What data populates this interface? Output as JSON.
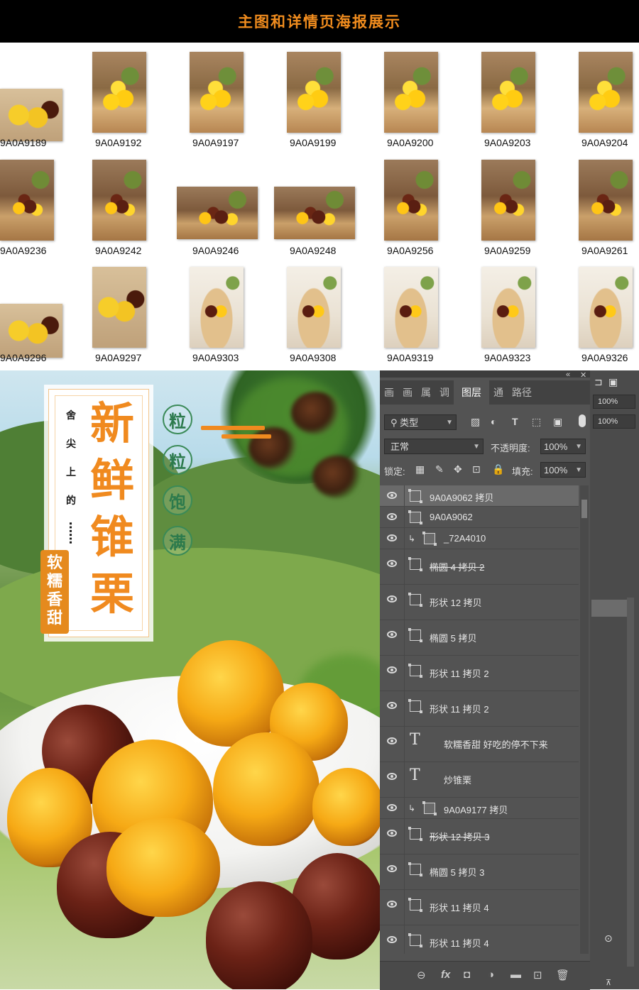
{
  "header": {
    "title": "主图和详情页海报展示"
  },
  "thumbnails": [
    {
      "id": "9A0A9189",
      "style": "ph-cut"
    },
    {
      "id": "9A0A9192",
      "style": "ph-yellow"
    },
    {
      "id": "9A0A9197",
      "style": "ph-yellow"
    },
    {
      "id": "9A0A9199",
      "style": "ph-yellow"
    },
    {
      "id": "9A0A9200",
      "style": "ph-yellow"
    },
    {
      "id": "9A0A9203",
      "style": "ph-yellow"
    },
    {
      "id": "9A0A9204",
      "style": "ph-yellow"
    },
    {
      "id": "9A0A9236",
      "style": "ph-mixed"
    },
    {
      "id": "9A0A9242",
      "style": "ph-mixed"
    },
    {
      "id": "9A0A9246",
      "style": "ph-mixed"
    },
    {
      "id": "9A0A9248",
      "style": "ph-mixed"
    },
    {
      "id": "9A0A9256",
      "style": "ph-mixed"
    },
    {
      "id": "9A0A9259",
      "style": "ph-mixed"
    },
    {
      "id": "9A0A9261",
      "style": "ph-mixed"
    },
    {
      "id": "9A0A9296",
      "style": "ph-cut"
    },
    {
      "id": "9A0A9297",
      "style": "ph-cut"
    },
    {
      "id": "9A0A9303",
      "style": "ph-cream"
    },
    {
      "id": "9A0A9308",
      "style": "ph-cream"
    },
    {
      "id": "9A0A9319",
      "style": "ph-cream"
    },
    {
      "id": "9A0A9323",
      "style": "ph-cream"
    },
    {
      "id": "9A0A9326",
      "style": "ph-cream"
    }
  ],
  "poster": {
    "small_chars": [
      "舍",
      "尖",
      "上",
      "的"
    ],
    "small_dots": "……",
    "big_chars": [
      "新",
      "鲜",
      "锥",
      "栗"
    ],
    "side_tag": [
      "软",
      "糯",
      "香",
      "甜"
    ],
    "circle_chars": [
      "粒",
      "粒",
      "饱",
      "满"
    ]
  },
  "photoshop": {
    "tabs": [
      "画",
      "画",
      "属",
      "调",
      "图层",
      "通",
      "路径"
    ],
    "active_tab": "图层",
    "filter_kind": "类型",
    "blend_mode": "正常",
    "opacity_label": "不透明度:",
    "opacity_value": "100%",
    "lock_label": "锁定:",
    "fill_label": "填充:",
    "fill_value": "100%",
    "right_field_1": "100%",
    "right_field_2": "100%",
    "layers": [
      {
        "name": "9A0A9062 拷贝",
        "type": "smart",
        "selected": true,
        "short": true
      },
      {
        "name": "9A0A9062",
        "type": "smart",
        "short": true
      },
      {
        "name": "_72A4010",
        "type": "smart",
        "clip": true,
        "short": true
      },
      {
        "name": "椭圆 4 拷贝 2",
        "type": "shape",
        "strike": true
      },
      {
        "name": "形状 12 拷贝",
        "type": "shape"
      },
      {
        "name": "椭圆 5 拷贝",
        "type": "shape"
      },
      {
        "name": "形状 11 拷贝 2",
        "type": "shape"
      },
      {
        "name": "形状 11 拷贝 2",
        "type": "shape"
      },
      {
        "name": "软糯香甜 好吃的停不下来",
        "type": "text"
      },
      {
        "name": "炒锥栗",
        "type": "text"
      },
      {
        "name": "9A0A9177 拷贝",
        "type": "smart",
        "clip": true,
        "short": true
      },
      {
        "name": "形状 12 拷贝 3",
        "type": "shape",
        "strike": true
      },
      {
        "name": "椭圆 5 拷贝 3",
        "type": "shape"
      },
      {
        "name": "形状 11 拷贝 4",
        "type": "shape"
      },
      {
        "name": "形状 11 拷贝 4",
        "type": "shape"
      }
    ],
    "bottom_icons": [
      "link-icon",
      "fx-icon",
      "mask-icon",
      "adjustment-icon",
      "folder-icon",
      "new-layer-icon",
      "trash-icon"
    ],
    "bottom_labels": {
      "link": "⊖",
      "fx": "fx",
      "mask": "◘",
      "adjust": "◑",
      "folder": "▬",
      "new": "⊡",
      "trash": "🗑"
    }
  }
}
